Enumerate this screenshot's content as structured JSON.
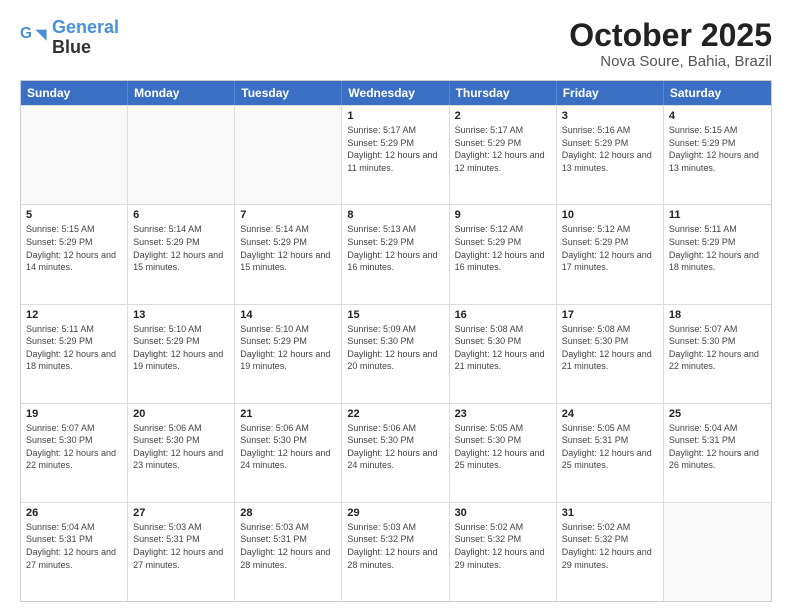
{
  "logo": {
    "line1": "General",
    "line2": "Blue"
  },
  "title": "October 2025",
  "location": "Nova Soure, Bahia, Brazil",
  "weekdays": [
    "Sunday",
    "Monday",
    "Tuesday",
    "Wednesday",
    "Thursday",
    "Friday",
    "Saturday"
  ],
  "rows": [
    [
      {
        "day": "",
        "info": ""
      },
      {
        "day": "",
        "info": ""
      },
      {
        "day": "",
        "info": ""
      },
      {
        "day": "1",
        "info": "Sunrise: 5:17 AM\nSunset: 5:29 PM\nDaylight: 12 hours and 11 minutes."
      },
      {
        "day": "2",
        "info": "Sunrise: 5:17 AM\nSunset: 5:29 PM\nDaylight: 12 hours and 12 minutes."
      },
      {
        "day": "3",
        "info": "Sunrise: 5:16 AM\nSunset: 5:29 PM\nDaylight: 12 hours and 13 minutes."
      },
      {
        "day": "4",
        "info": "Sunrise: 5:15 AM\nSunset: 5:29 PM\nDaylight: 12 hours and 13 minutes."
      }
    ],
    [
      {
        "day": "5",
        "info": "Sunrise: 5:15 AM\nSunset: 5:29 PM\nDaylight: 12 hours and 14 minutes."
      },
      {
        "day": "6",
        "info": "Sunrise: 5:14 AM\nSunset: 5:29 PM\nDaylight: 12 hours and 15 minutes."
      },
      {
        "day": "7",
        "info": "Sunrise: 5:14 AM\nSunset: 5:29 PM\nDaylight: 12 hours and 15 minutes."
      },
      {
        "day": "8",
        "info": "Sunrise: 5:13 AM\nSunset: 5:29 PM\nDaylight: 12 hours and 16 minutes."
      },
      {
        "day": "9",
        "info": "Sunrise: 5:12 AM\nSunset: 5:29 PM\nDaylight: 12 hours and 16 minutes."
      },
      {
        "day": "10",
        "info": "Sunrise: 5:12 AM\nSunset: 5:29 PM\nDaylight: 12 hours and 17 minutes."
      },
      {
        "day": "11",
        "info": "Sunrise: 5:11 AM\nSunset: 5:29 PM\nDaylight: 12 hours and 18 minutes."
      }
    ],
    [
      {
        "day": "12",
        "info": "Sunrise: 5:11 AM\nSunset: 5:29 PM\nDaylight: 12 hours and 18 minutes."
      },
      {
        "day": "13",
        "info": "Sunrise: 5:10 AM\nSunset: 5:29 PM\nDaylight: 12 hours and 19 minutes."
      },
      {
        "day": "14",
        "info": "Sunrise: 5:10 AM\nSunset: 5:29 PM\nDaylight: 12 hours and 19 minutes."
      },
      {
        "day": "15",
        "info": "Sunrise: 5:09 AM\nSunset: 5:30 PM\nDaylight: 12 hours and 20 minutes."
      },
      {
        "day": "16",
        "info": "Sunrise: 5:08 AM\nSunset: 5:30 PM\nDaylight: 12 hours and 21 minutes."
      },
      {
        "day": "17",
        "info": "Sunrise: 5:08 AM\nSunset: 5:30 PM\nDaylight: 12 hours and 21 minutes."
      },
      {
        "day": "18",
        "info": "Sunrise: 5:07 AM\nSunset: 5:30 PM\nDaylight: 12 hours and 22 minutes."
      }
    ],
    [
      {
        "day": "19",
        "info": "Sunrise: 5:07 AM\nSunset: 5:30 PM\nDaylight: 12 hours and 22 minutes."
      },
      {
        "day": "20",
        "info": "Sunrise: 5:06 AM\nSunset: 5:30 PM\nDaylight: 12 hours and 23 minutes."
      },
      {
        "day": "21",
        "info": "Sunrise: 5:06 AM\nSunset: 5:30 PM\nDaylight: 12 hours and 24 minutes."
      },
      {
        "day": "22",
        "info": "Sunrise: 5:06 AM\nSunset: 5:30 PM\nDaylight: 12 hours and 24 minutes."
      },
      {
        "day": "23",
        "info": "Sunrise: 5:05 AM\nSunset: 5:30 PM\nDaylight: 12 hours and 25 minutes."
      },
      {
        "day": "24",
        "info": "Sunrise: 5:05 AM\nSunset: 5:31 PM\nDaylight: 12 hours and 25 minutes."
      },
      {
        "day": "25",
        "info": "Sunrise: 5:04 AM\nSunset: 5:31 PM\nDaylight: 12 hours and 26 minutes."
      }
    ],
    [
      {
        "day": "26",
        "info": "Sunrise: 5:04 AM\nSunset: 5:31 PM\nDaylight: 12 hours and 27 minutes."
      },
      {
        "day": "27",
        "info": "Sunrise: 5:03 AM\nSunset: 5:31 PM\nDaylight: 12 hours and 27 minutes."
      },
      {
        "day": "28",
        "info": "Sunrise: 5:03 AM\nSunset: 5:31 PM\nDaylight: 12 hours and 28 minutes."
      },
      {
        "day": "29",
        "info": "Sunrise: 5:03 AM\nSunset: 5:32 PM\nDaylight: 12 hours and 28 minutes."
      },
      {
        "day": "30",
        "info": "Sunrise: 5:02 AM\nSunset: 5:32 PM\nDaylight: 12 hours and 29 minutes."
      },
      {
        "day": "31",
        "info": "Sunrise: 5:02 AM\nSunset: 5:32 PM\nDaylight: 12 hours and 29 minutes."
      },
      {
        "day": "",
        "info": ""
      }
    ]
  ]
}
